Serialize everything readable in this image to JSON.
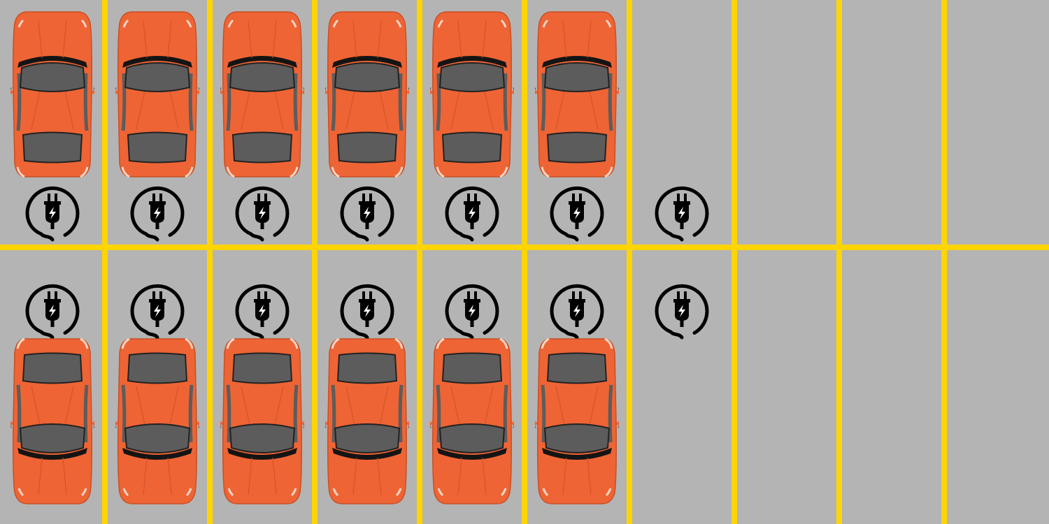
{
  "scene": {
    "columns": 10,
    "colors": {
      "asphalt": "#b4b4b4",
      "lane_line": "#ffd500",
      "car_body": "#ee6434",
      "car_glass": "#5c5c5c",
      "car_trim": "#141414",
      "charger_icon": "#000000"
    }
  },
  "top_row": [
    {
      "spot": 1,
      "charger": true,
      "charger_icon": "ev-plug-icon",
      "occupied": true
    },
    {
      "spot": 2,
      "charger": true,
      "charger_icon": "ev-plug-icon",
      "occupied": true
    },
    {
      "spot": 3,
      "charger": true,
      "charger_icon": "ev-plug-icon",
      "occupied": true
    },
    {
      "spot": 4,
      "charger": true,
      "charger_icon": "ev-plug-icon",
      "occupied": true
    },
    {
      "spot": 5,
      "charger": true,
      "charger_icon": "ev-plug-icon",
      "occupied": true
    },
    {
      "spot": 6,
      "charger": true,
      "charger_icon": "ev-plug-icon",
      "occupied": true
    },
    {
      "spot": 7,
      "charger": true,
      "charger_icon": "ev-plug-icon",
      "occupied": false
    },
    {
      "spot": 8,
      "charger": false,
      "occupied": false
    },
    {
      "spot": 9,
      "charger": false,
      "occupied": false
    },
    {
      "spot": 10,
      "charger": false,
      "occupied": false
    }
  ],
  "bottom_row": [
    {
      "spot": 1,
      "charger": true,
      "charger_icon": "ev-plug-icon",
      "occupied": true
    },
    {
      "spot": 2,
      "charger": true,
      "charger_icon": "ev-plug-icon",
      "occupied": true
    },
    {
      "spot": 3,
      "charger": true,
      "charger_icon": "ev-plug-icon",
      "occupied": true
    },
    {
      "spot": 4,
      "charger": true,
      "charger_icon": "ev-plug-icon",
      "occupied": true
    },
    {
      "spot": 5,
      "charger": true,
      "charger_icon": "ev-plug-icon",
      "occupied": true
    },
    {
      "spot": 6,
      "charger": true,
      "charger_icon": "ev-plug-icon",
      "occupied": true
    },
    {
      "spot": 7,
      "charger": true,
      "charger_icon": "ev-plug-icon",
      "occupied": false
    },
    {
      "spot": 8,
      "charger": false,
      "occupied": false
    },
    {
      "spot": 9,
      "charger": false,
      "occupied": false
    },
    {
      "spot": 10,
      "charger": false,
      "occupied": false
    }
  ]
}
